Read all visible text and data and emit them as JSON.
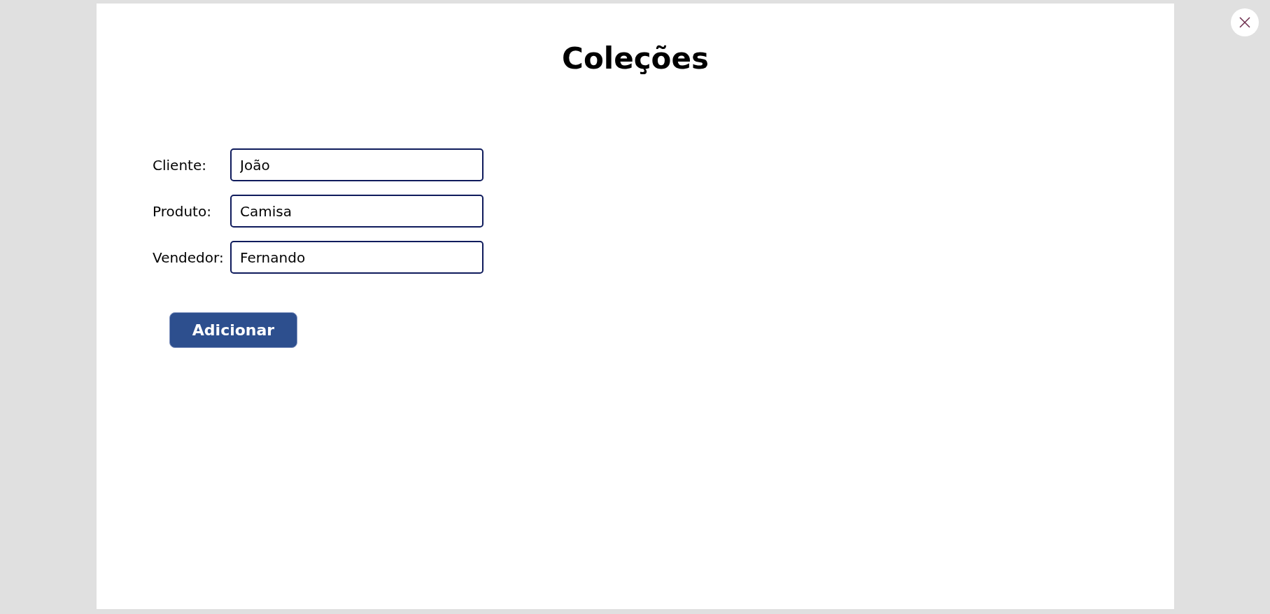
{
  "title": "Coleções",
  "fields": [
    {
      "label": "Cliente:",
      "value": "João"
    },
    {
      "label": "Produto:",
      "value": "Camisa"
    },
    {
      "label": "Vendedor:",
      "value": "Fernando"
    }
  ],
  "button": "Adicionar"
}
